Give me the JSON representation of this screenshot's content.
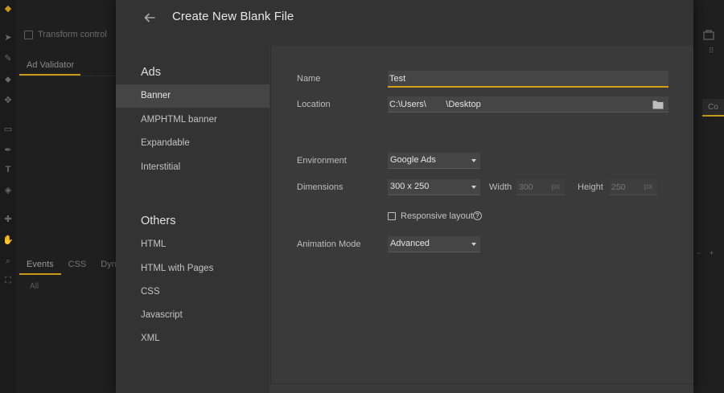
{
  "background": {
    "toolbar_transform": "Transform control",
    "panel_tab": "Ad Validator",
    "events_tabs": [
      "Events",
      "CSS",
      "Dyna"
    ],
    "events_filter": "All",
    "right_tab": "Co",
    "accent": "#c89a1a"
  },
  "dialog": {
    "title": "Create New Blank File",
    "sidebar": {
      "ads_heading": "Ads",
      "ads_items": [
        "Banner",
        "AMPHTML banner",
        "Expandable",
        "Interstitial"
      ],
      "selected": "Banner",
      "others_heading": "Others",
      "others_items": [
        "HTML",
        "HTML with Pages",
        "CSS",
        "Javascript",
        "XML"
      ]
    },
    "form": {
      "name_label": "Name",
      "name_value": "Test",
      "location_label": "Location",
      "location_value": "C:\\Users\\        \\Desktop",
      "environment_label": "Environment",
      "environment_value": "Google Ads",
      "dimensions_label": "Dimensions",
      "dimensions_value": "300 x 250",
      "width_label": "Width",
      "width_value": "300",
      "height_label": "Height",
      "height_value": "250",
      "unit": "px",
      "responsive_label": "Responsive layout",
      "responsive_checked": false,
      "animation_label": "Animation Mode",
      "animation_value": "Advanced"
    },
    "focus_color": "#d4a017"
  }
}
